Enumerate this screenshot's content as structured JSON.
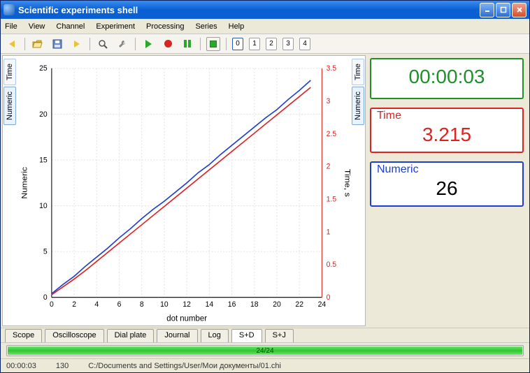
{
  "window": {
    "title": "Scientific experiments shell"
  },
  "menubar": [
    "File",
    "View",
    "Channel",
    "Experiment",
    "Processing",
    "Series",
    "Help"
  ],
  "toolbar": {
    "pages": [
      "0",
      "1",
      "2",
      "3",
      "4"
    ],
    "active_page": 0
  },
  "left_tabs": [
    "Time",
    "Numeric"
  ],
  "right_tabs": [
    "Time",
    "Numeric"
  ],
  "chart_data": {
    "type": "line",
    "title": "",
    "xlabel": "dot number",
    "ylabel_left": "Numeric",
    "ylabel_right": "Time, s",
    "x": [
      0,
      1,
      2,
      3,
      4,
      5,
      6,
      7,
      8,
      9,
      10,
      11,
      12,
      13,
      14,
      15,
      16,
      17,
      18,
      19,
      20,
      21,
      22,
      23
    ],
    "x_ticks": [
      0,
      2,
      4,
      6,
      8,
      10,
      12,
      14,
      16,
      18,
      20,
      22,
      24
    ],
    "y1_ticks": [
      0,
      5,
      10,
      15,
      20,
      25
    ],
    "y2_ticks": [
      0,
      0.5,
      1,
      1.5,
      2,
      2.5,
      3,
      3.5
    ],
    "xlim": [
      0,
      24
    ],
    "y1_lim": [
      0,
      25
    ],
    "y2_lim": [
      0,
      3.5
    ],
    "series": [
      {
        "name": "Numeric",
        "axis": "left",
        "color": "#1d3ed3",
        "values": [
          0.4,
          1.4,
          2.3,
          3.4,
          4.4,
          5.4,
          6.5,
          7.5,
          8.6,
          9.6,
          10.5,
          11.5,
          12.5,
          13.6,
          14.5,
          15.6,
          16.6,
          17.6,
          18.6,
          19.6,
          20.5,
          21.6,
          22.6,
          23.7
        ]
      },
      {
        "name": "Time",
        "axis": "right",
        "color": "#d22",
        "values": [
          0.04,
          0.16,
          0.28,
          0.41,
          0.55,
          0.69,
          0.83,
          0.97,
          1.11,
          1.25,
          1.39,
          1.53,
          1.67,
          1.81,
          1.95,
          2.09,
          2.23,
          2.37,
          2.51,
          2.65,
          2.79,
          2.93,
          3.07,
          3.21
        ]
      }
    ]
  },
  "readouts": {
    "clock": {
      "value": "00:00:03"
    },
    "time": {
      "label": "Time",
      "value": "3.215"
    },
    "numeric": {
      "label": "Numeric",
      "value": "26"
    }
  },
  "bottom_tabs": [
    "Scope",
    "Oscilloscope",
    "Dial plate",
    "Journal",
    "Log",
    "S+D",
    "S+J"
  ],
  "bottom_active": "S+D",
  "progress": {
    "text": "24/24",
    "percent": 100
  },
  "statusbar": {
    "time": "00:00:03",
    "count": "130",
    "path": "C:/Documents and Settings/User/Мои документы/01.chi"
  }
}
